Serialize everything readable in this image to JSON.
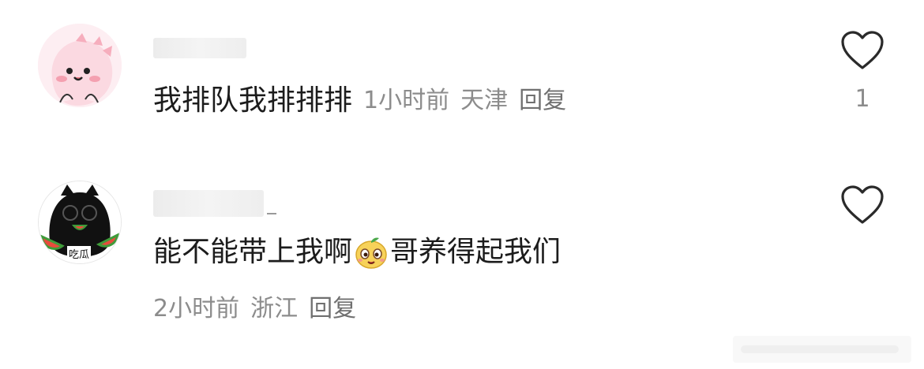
{
  "comments": [
    {
      "text": "我排队我排排排",
      "time": "1小时前",
      "location": "天津",
      "reply_label": "回复",
      "like_count": "1"
    },
    {
      "text_before_emoji": "能不能带上我啊",
      "emoji": "sticker-emoji",
      "text_after_emoji": "哥养得起我们",
      "time": "2小时前",
      "location": "浙江",
      "reply_label": "回复",
      "like_count": ""
    }
  ],
  "avatar2_text": "吃瓜",
  "colors": {
    "text": "#1c1c1c",
    "meta": "#8c8c8c",
    "background": "#ffffff"
  },
  "icons": [
    "heart-outline-icon",
    "avatar-pink-dino",
    "avatar-black-cat",
    "watermelon-sticker-emoji"
  ]
}
